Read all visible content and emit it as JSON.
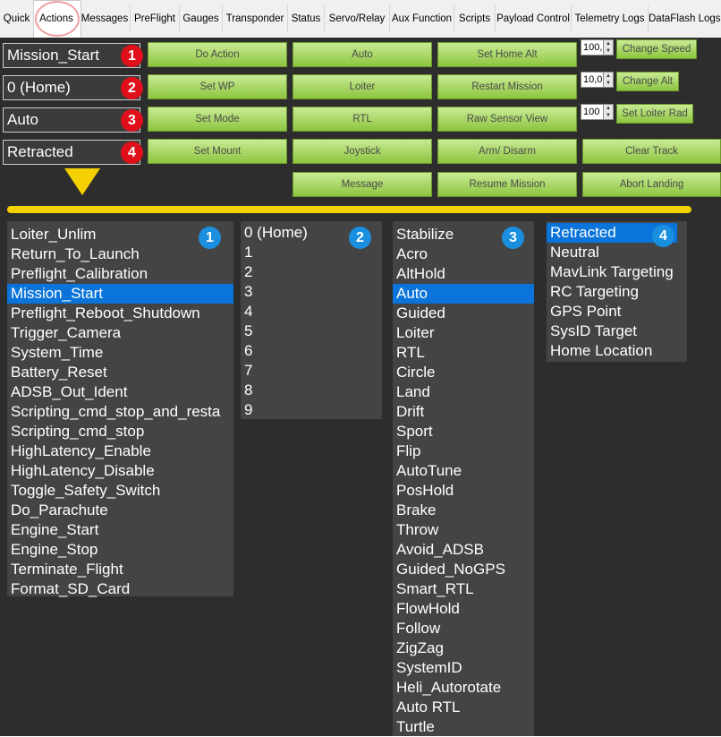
{
  "tabs": [
    "Quick",
    "Actions",
    "Messages",
    "PreFlight",
    "Gauges",
    "Transponder",
    "Status",
    "Servo/Relay",
    "Aux Function",
    "Scripts",
    "Payload Control",
    "Telemetry Logs",
    "DataFlash Logs"
  ],
  "combos": [
    "Mission_Start",
    "0 (Home)",
    "Auto",
    "Retracted"
  ],
  "badges": [
    "1",
    "2",
    "3",
    "4"
  ],
  "buttons": {
    "do_action": "Do Action",
    "auto": "Auto",
    "set_home_alt": "Set Home Alt",
    "set_wp": "Set WP",
    "loiter": "Loiter",
    "restart_mission": "Restart Mission",
    "set_mode": "Set Mode",
    "rtl": "RTL",
    "raw_sensor_view": "Raw Sensor View",
    "set_mount": "Set Mount",
    "joystick": "Joystick",
    "arm_disarm": "Arm/ Disarm",
    "clear_track": "Clear Track",
    "message": "Message",
    "resume_mission": "Resume Mission",
    "abort_landing": "Abort Landing",
    "change_speed": "Change Speed",
    "change_alt": "Change Alt",
    "set_loiter_rad": "Set Loiter Rad"
  },
  "numerics": {
    "speed": "100,",
    "alt": "10,0",
    "loiter_rad": "100"
  },
  "lists": {
    "actions": [
      "Loiter_Unlim",
      "Return_To_Launch",
      "Preflight_Calibration",
      "Mission_Start",
      "Preflight_Reboot_Shutdown",
      "Trigger_Camera",
      "System_Time",
      "Battery_Reset",
      "ADSB_Out_Ident",
      "Scripting_cmd_stop_and_resta",
      "Scripting_cmd_stop",
      "HighLatency_Enable",
      "HighLatency_Disable",
      "Toggle_Safety_Switch",
      "Do_Parachute",
      "Engine_Start",
      "Engine_Stop",
      "Terminate_Flight",
      "Format_SD_Card"
    ],
    "waypoints": [
      "0 (Home)",
      "1",
      "2",
      "3",
      "4",
      "5",
      "6",
      "7",
      "8",
      "9"
    ],
    "modes": [
      "Stabilize",
      "Acro",
      "AltHold",
      "Auto",
      "Guided",
      "Loiter",
      "RTL",
      "Circle",
      "Land",
      "Drift",
      "Sport",
      "Flip",
      "AutoTune",
      "PosHold",
      "Brake",
      "Throw",
      "Avoid_ADSB",
      "Guided_NoGPS",
      "Smart_RTL",
      "FlowHold",
      "Follow",
      "ZigZag",
      "SystemID",
      "Heli_Autorotate",
      "Auto RTL",
      "Turtle"
    ],
    "mount": [
      "Retracted",
      "Neutral",
      "MavLink Targeting",
      "RC Targeting",
      "GPS Point",
      "SysID Target",
      "Home Location"
    ]
  },
  "selected": {
    "actions": 3,
    "waypoints": -1,
    "modes": 3,
    "mount": 0
  },
  "colors": {
    "panel": "#2d2d2d",
    "list_bg": "#444444",
    "selection": "#0a74da",
    "badge_red": "#e0101a",
    "badge_blue": "#1a8fe0",
    "highlight_yellow": "#f5d000"
  }
}
